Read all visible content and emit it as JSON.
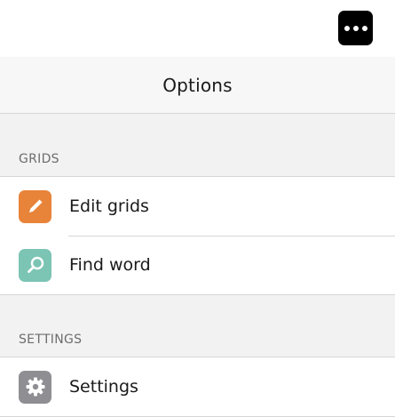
{
  "toolbar": {
    "more_icon": "ellipsis-icon"
  },
  "options": {
    "title": "Options",
    "sections": [
      {
        "label": "GRIDS",
        "items": [
          {
            "label": "Edit grids",
            "icon": "pencil-icon",
            "icon_color": "#e8833a"
          },
          {
            "label": "Find word",
            "icon": "magnifier-icon",
            "icon_color": "#7cc4b4"
          }
        ]
      },
      {
        "label": "SETTINGS",
        "items": [
          {
            "label": "Settings",
            "icon": "gear-icon",
            "icon_color": "#8e8e93"
          }
        ]
      }
    ]
  }
}
